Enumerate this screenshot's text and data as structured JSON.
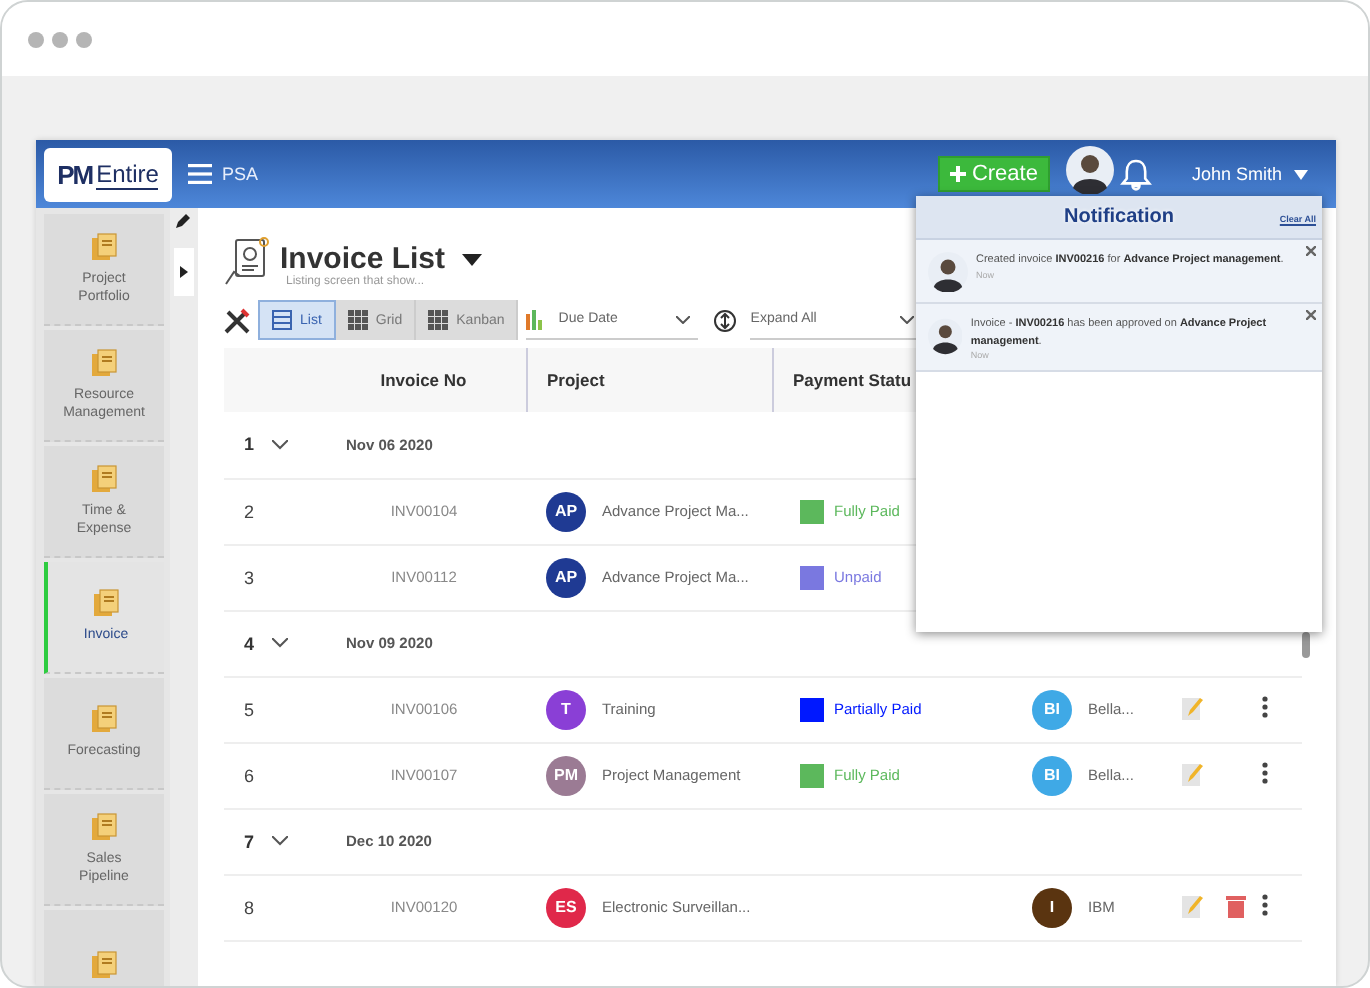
{
  "header": {
    "logo_mark": "PM",
    "logo_text": "Entire",
    "app": "PSA",
    "create": "Create",
    "user": "John Smith"
  },
  "sidebar": {
    "items": [
      {
        "label": "Project Portfolio",
        "selected": false
      },
      {
        "label": "Resource Management",
        "selected": false
      },
      {
        "label": "Time & Expense",
        "selected": false
      },
      {
        "label": "Invoice",
        "selected": true
      },
      {
        "label": "Forecasting",
        "selected": false
      },
      {
        "label": "Sales Pipeline",
        "selected": false
      },
      {
        "selected": false
      }
    ]
  },
  "page": {
    "title": "Invoice List",
    "subtitle": "Listing screen that show...",
    "views": [
      {
        "label": "List",
        "selected": true
      },
      {
        "label": "Grid",
        "selected": false
      },
      {
        "label": "Kanban",
        "selected": false
      }
    ],
    "sort": "Due Date",
    "expand": "Expand All"
  },
  "table": {
    "columns": [
      "Invoice No",
      "Project",
      "Payment Statu"
    ],
    "rows": [
      {
        "kind": "group",
        "num": "1",
        "date": "Nov 06 2020"
      },
      {
        "kind": "item",
        "num": "2",
        "invoice": "INV00104",
        "project": {
          "initials": "AP",
          "name": "Advance Project Ma...",
          "color": "#1f3a93"
        },
        "payment": {
          "label": "Fully Paid",
          "color": "#5cb85c"
        },
        "edit": false,
        "delete": false,
        "more": false
      },
      {
        "kind": "item",
        "num": "3",
        "invoice": "INV00112",
        "project": {
          "initials": "AP",
          "name": "Advance Project Ma...",
          "color": "#1f3a93"
        },
        "payment": {
          "label": "Unpaid",
          "color": "#7a78e0"
        },
        "edit": false,
        "delete": false,
        "more": false
      },
      {
        "kind": "group",
        "num": "4",
        "date": "Nov 09 2020"
      },
      {
        "kind": "item",
        "num": "5",
        "invoice": "INV00106",
        "project": {
          "initials": "T",
          "name": "Training",
          "color": "#8a3fd6"
        },
        "payment": {
          "label": "Partially Paid",
          "color": "#0018ff"
        },
        "client": {
          "initials": "BI",
          "name": "Bella...",
          "color": "#3fa9e6"
        },
        "edit": true,
        "delete": false,
        "more": true
      },
      {
        "kind": "item",
        "num": "6",
        "invoice": "INV00107",
        "project": {
          "initials": "PM",
          "name": "Project Management",
          "color": "#9b7b94"
        },
        "payment": {
          "label": "Fully Paid",
          "color": "#5cb85c"
        },
        "client": {
          "initials": "BI",
          "name": "Bella...",
          "color": "#3fa9e6"
        },
        "edit": true,
        "delete": false,
        "more": true
      },
      {
        "kind": "group",
        "num": "7",
        "date": "Dec 10 2020"
      },
      {
        "kind": "item",
        "num": "8",
        "invoice": "INV00120",
        "project": {
          "initials": "ES",
          "name": "Electronic Surveillan...",
          "color": "#e0284a"
        },
        "client": {
          "initials": "I",
          "name": "IBM",
          "color": "#5a3410"
        },
        "edit": true,
        "delete": true,
        "more": true
      }
    ]
  },
  "notifications": {
    "title": "Notification",
    "clear": "Clear All",
    "items": [
      {
        "text": "Created invoice **INV00216** for **Advance Project management**.",
        "time": "Now"
      },
      {
        "text": "Invoice - **INV00216** has been approved on **Advance Project management**.",
        "time": "Now"
      }
    ]
  }
}
